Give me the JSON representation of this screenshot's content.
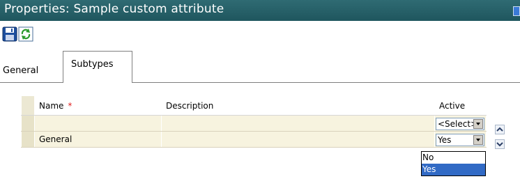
{
  "window": {
    "title": "Properties: Sample custom attribute"
  },
  "toolbar": {
    "save_icon": "save-icon",
    "refresh_icon": "refresh-icon"
  },
  "tabs": [
    {
      "label": "General",
      "active": false
    },
    {
      "label": "Subtypes",
      "active": true
    }
  ],
  "grid": {
    "columns": [
      "Name",
      "Description",
      "Active"
    ],
    "required_marker": "*",
    "rows": [
      {
        "name": "",
        "description": "",
        "active": "<Select>"
      },
      {
        "name": "General",
        "description": "",
        "active": "Yes"
      }
    ]
  },
  "dropdown": {
    "options": [
      "No",
      "Yes"
    ],
    "selected": "Yes"
  },
  "colors": {
    "titlebar": "#2a6570",
    "row_bg": "#f7f3df",
    "row_header": "#e7e2c8",
    "selection": "#316ac5"
  }
}
